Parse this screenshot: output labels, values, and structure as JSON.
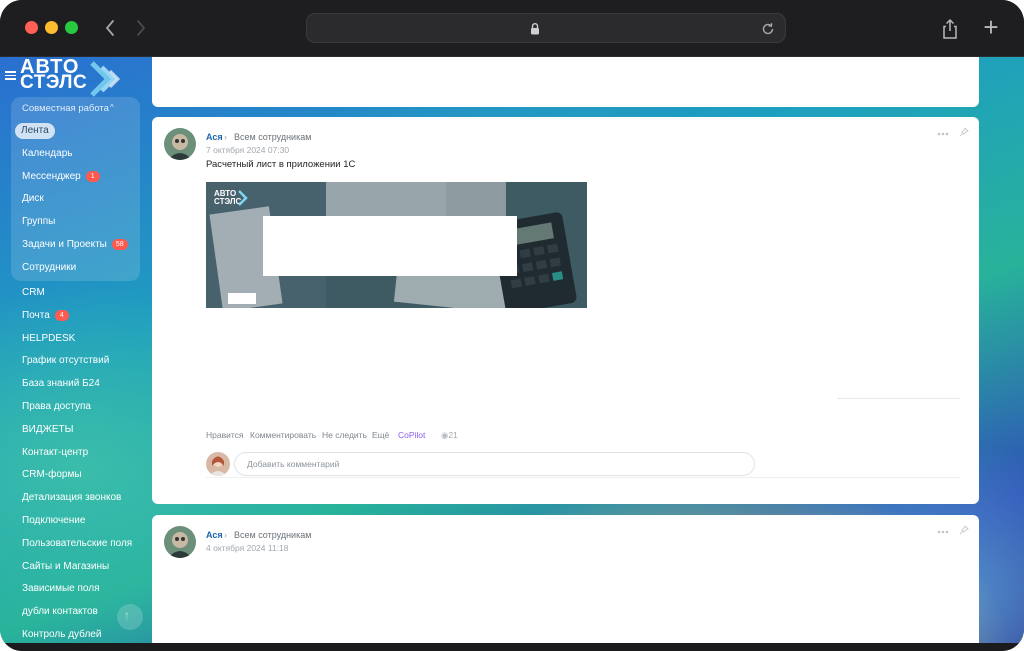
{
  "sidebar": {
    "logo_line1": "АВТО",
    "logo_line2": "СТЭЛС",
    "group_title": "Совместная работа",
    "group_items": [
      {
        "label": "Лента",
        "active": true
      },
      {
        "label": "Календарь"
      },
      {
        "label": "Мессенджер",
        "badge": "1"
      },
      {
        "label": "Диск"
      },
      {
        "label": "Группы"
      },
      {
        "label": "Задачи и Проекты",
        "badge": "58"
      },
      {
        "label": "Сотрудники"
      }
    ],
    "items": [
      {
        "label": "CRM"
      },
      {
        "label": "Почта",
        "badge": "4"
      },
      {
        "label": "HELPDESK"
      },
      {
        "label": "График отсутствий"
      },
      {
        "label": "База знаний Б24"
      },
      {
        "label": "Права доступа"
      },
      {
        "label": "ВИДЖЕТЫ"
      },
      {
        "label": "Контакт-центр"
      },
      {
        "label": "CRM-формы"
      },
      {
        "label": "Детализация звонков"
      },
      {
        "label": "Подключение"
      },
      {
        "label": "Пользовательские поля"
      },
      {
        "label": "Сайты и Магазины"
      },
      {
        "label": "Зависимые поля"
      },
      {
        "label": "дубли контактов"
      },
      {
        "label": "Контроль дублей"
      }
    ]
  },
  "post": {
    "author": "Ася",
    "destination": "Всем сотрудникам",
    "date": "7 октября 2024 07:30",
    "text": "Расчетный лист в приложении 1С",
    "banner_logo_line1": "АВТО",
    "banner_logo_line2": "СТЭЛС",
    "actions": {
      "like": "Нравится",
      "comment": "Комментировать",
      "unfollow": "Не следить",
      "more": "Ещё",
      "copilot": "CoPilot"
    },
    "views": "21",
    "comment_placeholder": "Добавить комментарий"
  },
  "next_post": {
    "author": "Ася",
    "destination": "Всем сотрудникам",
    "date": "4 октября 2024 11:18"
  },
  "colors": {
    "accent_link": "#2067b0",
    "badge": "#ff5a4f",
    "copilot": "#8a5cf6"
  }
}
